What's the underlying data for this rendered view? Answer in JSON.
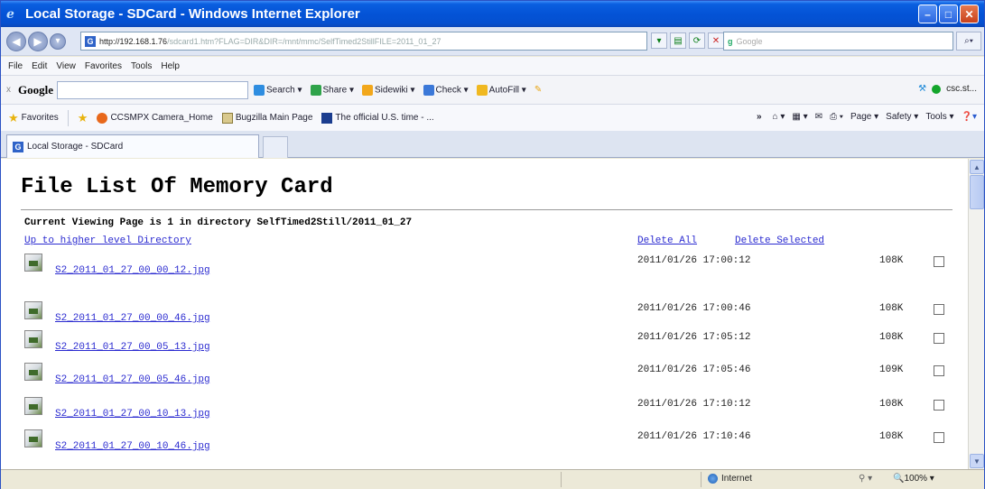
{
  "window": {
    "title": "Local Storage - SDCard - Windows Internet Explorer",
    "minimize": "–",
    "maximize": "□",
    "close": "✕"
  },
  "address_bar": {
    "url_host": "http://192.168.1.76",
    "url_path": "/sdcard1.htm?FLAG=DIR&DIR=/mnt/mmc/SelfTimed2StillFILE=2011_01_27",
    "search_placeholder": "Google"
  },
  "menu": [
    "File",
    "Edit",
    "View",
    "Favorites",
    "Tools",
    "Help"
  ],
  "google_toolbar": {
    "close": "x",
    "logo": "Google",
    "tools": [
      "Search",
      "Share",
      "Sidewiki",
      "Check",
      "AutoFill"
    ],
    "user": "csc.st..."
  },
  "favorites_bar": {
    "label": "Favorites",
    "items": [
      "CCSMPX Camera_Home",
      "Bugzilla Main Page",
      "The official U.S. time - ..."
    ],
    "right_tools": [
      "Page",
      "Safety",
      "Tools"
    ]
  },
  "tab": {
    "label": "Local Storage - SDCard"
  },
  "page": {
    "title": "File List Of Memory Card",
    "viewing": "Current Viewing Page is 1 in directory SelfTimed2Still/2011_01_27",
    "up_link": "Up to higher level Directory",
    "delete_all": "Delete All",
    "delete_selected": "Delete Selected",
    "files": [
      {
        "name": "S2_2011_01_27_00_00_12.jpg",
        "date": "2011/01/26  17:00:12",
        "size": "108K"
      },
      {
        "name": "S2_2011_01_27_00_00_46.jpg",
        "date": "2011/01/26  17:00:46",
        "size": "108K"
      },
      {
        "name": "S2_2011_01_27_00_05_13.jpg",
        "date": "2011/01/26  17:05:12",
        "size": "108K"
      },
      {
        "name": "S2_2011_01_27_00_05_46.jpg",
        "date": "2011/01/26  17:05:46",
        "size": "109K"
      },
      {
        "name": "S2_2011_01_27_00_10_13.jpg",
        "date": "2011/01/26  17:10:12",
        "size": "108K"
      },
      {
        "name": "S2_2011_01_27_00_10_46.jpg",
        "date": "2011/01/26  17:10:46",
        "size": "108K"
      }
    ]
  },
  "status_bar": {
    "zone": "Internet",
    "zoom": "100%"
  },
  "colors": {
    "titlebar": "#0453d6",
    "link": "#2b2bd0"
  }
}
